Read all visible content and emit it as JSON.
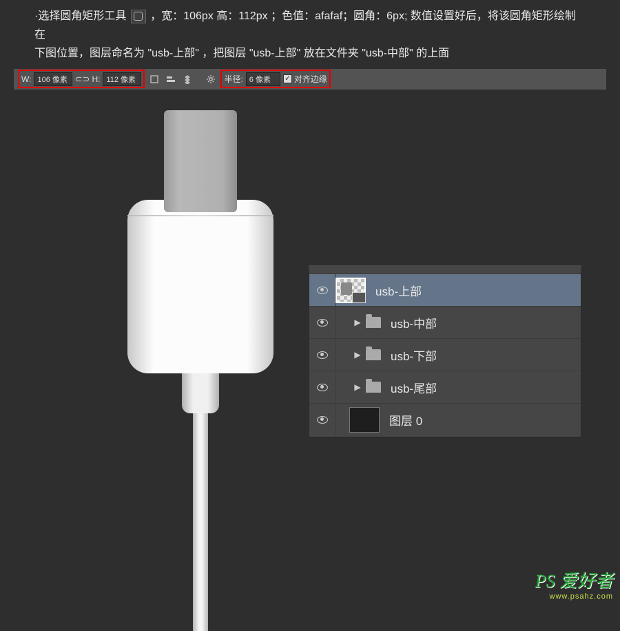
{
  "instructions": {
    "line1_prefix": "·选择圆角矩形工具 ",
    "line1_suffix": " ，宽：106px  高：112px ；色值：afafaf；圆角：6px; 数值设置好后，将该圆角矩形绘制在",
    "line2": "下图位置，图层命名为 \"usb-上部\" ，把图层 \"usb-上部\" 放在文件夹 \"usb-中部\" 的上面"
  },
  "options_bar": {
    "w_label": "W:",
    "w_value": "106 像素",
    "h_label": "H:",
    "h_value": "112 像素",
    "radius_label": "半径:",
    "radius_value": "6 像素",
    "align_label": "对齐边缘"
  },
  "layers": {
    "items": [
      {
        "name": "usb-上部",
        "type": "shape",
        "selected": true
      },
      {
        "name": "usb-中部",
        "type": "folder"
      },
      {
        "name": "usb-下部",
        "type": "folder"
      },
      {
        "name": "usb-尾部",
        "type": "folder"
      },
      {
        "name": "图层 0",
        "type": "bg"
      }
    ]
  },
  "watermark": {
    "title": "PS 爱好者",
    "url": "www.psahz.com"
  },
  "colors": {
    "highlight": "#e40000",
    "selected_layer": "#657589"
  }
}
